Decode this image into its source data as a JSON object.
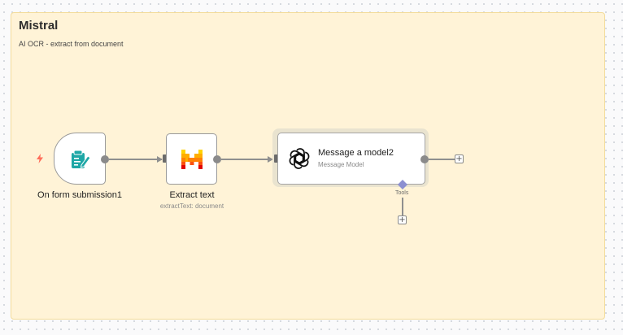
{
  "sticky_note": {
    "title": "Mistral",
    "subtitle": "AI OCR - extract from document"
  },
  "nodes": {
    "trigger": {
      "label": "On form submission1",
      "icon": "form-icon",
      "color": "#1ea7a6",
      "trigger_icon": "lightning-icon",
      "trigger_color": "#ff6d5a"
    },
    "extract": {
      "label": "Extract text",
      "sublabel": "extractText: document",
      "icon": "mistral-logo-icon"
    },
    "llm": {
      "title": "Message a model2",
      "subtitle": "Message Model",
      "icon": "openai-logo-icon"
    }
  },
  "tools_connector": {
    "label": "Tools",
    "color": "#8c8fd1"
  },
  "add_button": {
    "glyph": "+"
  }
}
